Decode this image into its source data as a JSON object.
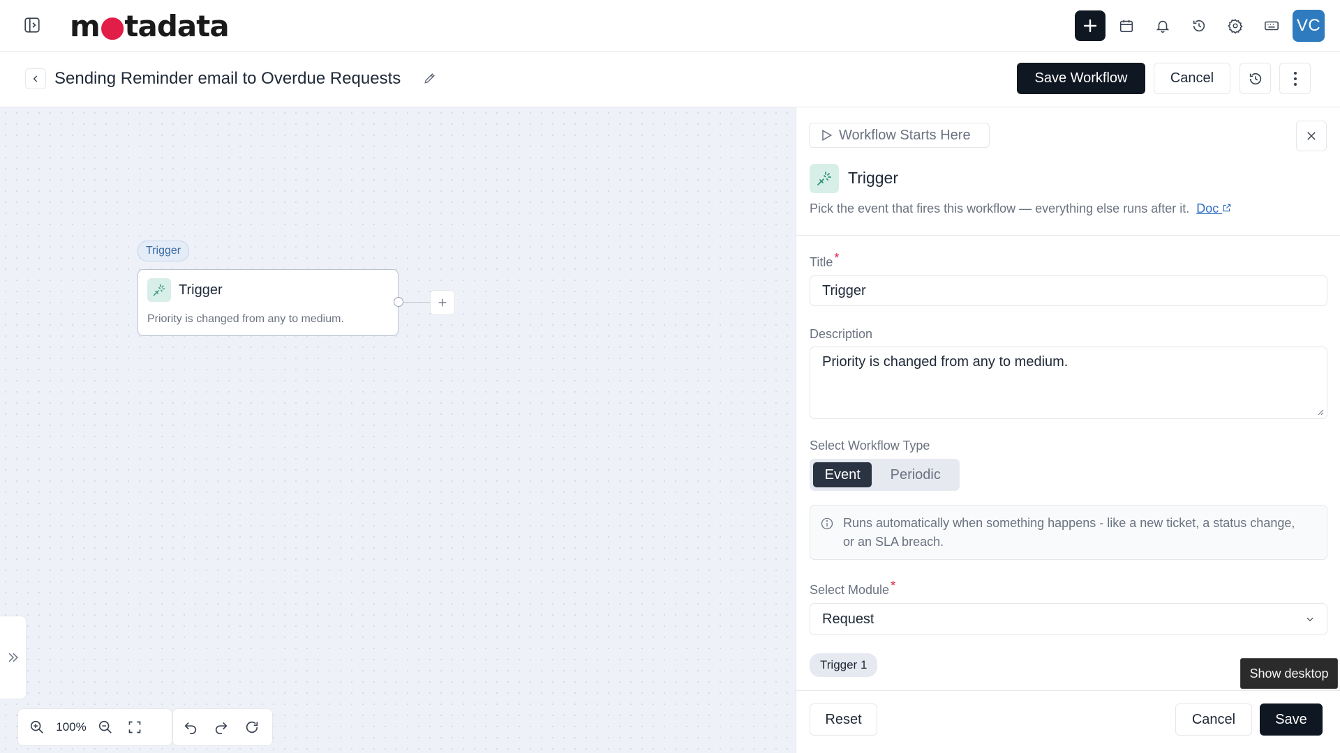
{
  "header": {
    "logo_text_a": "m",
    "logo_text_b": "tadata",
    "avatar_initials": "VC"
  },
  "titlebar": {
    "title": "Sending Reminder email to Overdue Requests",
    "save_workflow_label": "Save Workflow",
    "cancel_label": "Cancel"
  },
  "canvas": {
    "node_tag": "Trigger",
    "node_title": "Trigger",
    "node_description": "Priority is changed from any to medium.",
    "zoom_level": "100%"
  },
  "panel": {
    "start_label": "Workflow Starts Here",
    "title": "Trigger",
    "description": "Pick the event that fires this workflow — everything else runs after it.",
    "doc_link": "Doc",
    "title_label": "Title",
    "title_value": "Trigger",
    "description_label": "Description",
    "description_value": "Priority is changed from any to medium.",
    "workflow_type_label": "Select Workflow Type",
    "workflow_types": [
      "Event",
      "Periodic"
    ],
    "selected_workflow_type": "Event",
    "info_text": "Runs automatically when something happens - like a new ticket, a status change, or an SLA breach.",
    "module_label": "Select Module",
    "module_value": "Request",
    "trigger_chip": "Trigger 1",
    "reset_label": "Reset",
    "cancel_label": "Cancel",
    "save_label": "Save"
  },
  "tooltip": {
    "text": "Show desktop"
  },
  "colors": {
    "primary_dark": "#0f1722",
    "accent_blue": "#2f7bbf",
    "required_red": "#e11d48",
    "trigger_icon_bg": "#d7efe8"
  }
}
